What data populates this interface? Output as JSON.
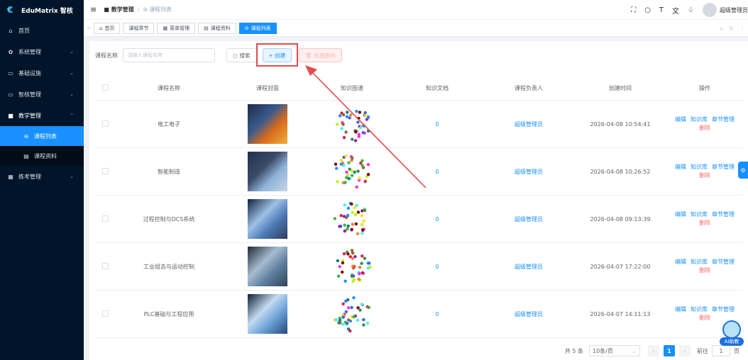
{
  "app": {
    "title": "EduMatrix 智核"
  },
  "sidebar": {
    "items": [
      {
        "label": "首页",
        "icon": "home-icon"
      },
      {
        "label": "系统管理",
        "icon": "gear-icon"
      },
      {
        "label": "基础设施",
        "icon": "monitor-icon"
      },
      {
        "label": "智核管理",
        "icon": "monitor-icon"
      },
      {
        "label": "教学管理",
        "icon": "teaching-icon"
      },
      {
        "label": "练考管理",
        "icon": "grid-icon"
      }
    ],
    "sub_items": [
      {
        "label": "课程列表",
        "active": true
      },
      {
        "label": "课程资料",
        "active": false
      }
    ]
  },
  "header": {
    "breadcrumb": [
      "教学管理",
      "课程列表"
    ],
    "username": "超级管理员"
  },
  "tabs": [
    {
      "label": "首页"
    },
    {
      "label": "课程章节"
    },
    {
      "label": "菜单管理"
    },
    {
      "label": "课程资料"
    },
    {
      "label": "课程列表",
      "active": true
    }
  ],
  "search": {
    "label": "课程名称",
    "placeholder": "请输入课程名称",
    "search_label": "搜索",
    "create_label": "+ 创建",
    "batch_delete_label": "批量删除"
  },
  "table": {
    "headers": [
      "课程名称",
      "课程封面",
      "知识图谱",
      "知识文档",
      "课程负责人",
      "创建时间",
      "操作"
    ],
    "rows": [
      {
        "name": "电工电子",
        "docs": "0",
        "owner": "超级管理员",
        "created": "2026-04-08 10:54:41"
      },
      {
        "name": "智能制造",
        "docs": "0",
        "owner": "超级管理员",
        "created": "2026-04-08 10:26:52"
      },
      {
        "name": "过程控制与DCS系统",
        "docs": "0",
        "owner": "超级管理员",
        "created": "2026-04-08 09:13:39"
      },
      {
        "name": "工业组态与运动控制",
        "docs": "0",
        "owner": "超级管理员",
        "created": "2026-04-07 17:22:00"
      },
      {
        "name": "PLC基础与工程应用",
        "docs": "0",
        "owner": "超级管理员",
        "created": "2026-04-07 14:11:13"
      }
    ],
    "actions": {
      "edit": "编辑",
      "kb": "知识库",
      "chapters": "章节管理",
      "delete": "删除"
    }
  },
  "pagination": {
    "total": "共 5 条",
    "page_size": "10条/页",
    "current_page": "1",
    "goto_label": "前往",
    "goto_value": "1",
    "page_suffix": "页"
  },
  "assistant": {
    "label": "AI助教"
  },
  "colors": {
    "primary": "#1890ff",
    "sidebar_bg": "#001529",
    "danger": "#f56c6c",
    "annotation": "#e24c4c"
  }
}
